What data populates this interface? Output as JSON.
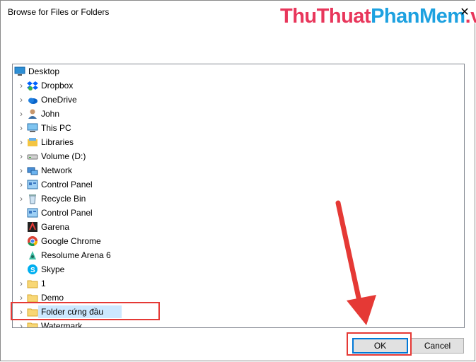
{
  "dialog": {
    "title": "Browse for Files or Folders",
    "watermark_part1": "ThuThuat",
    "watermark_part2": "PhanMem",
    "watermark_part3": ".vn",
    "close_symbol": "✕"
  },
  "tree": {
    "items": [
      {
        "label": "Desktop",
        "icon": "desktop-icon",
        "expander": false,
        "indent": 0
      },
      {
        "label": "Dropbox",
        "icon": "dropbox-icon",
        "expander": true,
        "indent": 1
      },
      {
        "label": "OneDrive",
        "icon": "onedrive-icon",
        "expander": true,
        "indent": 1
      },
      {
        "label": "John",
        "icon": "user-icon",
        "expander": true,
        "indent": 1
      },
      {
        "label": "This PC",
        "icon": "this-pc-icon",
        "expander": true,
        "indent": 1
      },
      {
        "label": "Libraries",
        "icon": "libraries-icon",
        "expander": true,
        "indent": 1
      },
      {
        "label": "Volume (D:)",
        "icon": "drive-icon",
        "expander": true,
        "indent": 1
      },
      {
        "label": "Network",
        "icon": "network-icon",
        "expander": true,
        "indent": 1
      },
      {
        "label": "Control Panel",
        "icon": "control-panel-icon",
        "expander": true,
        "indent": 1
      },
      {
        "label": "Recycle Bin",
        "icon": "recycle-bin-icon",
        "expander": true,
        "indent": 1
      },
      {
        "label": "Control Panel",
        "icon": "control-panel-icon",
        "expander": false,
        "indent": 1
      },
      {
        "label": "Garena",
        "icon": "garena-icon",
        "expander": false,
        "indent": 1
      },
      {
        "label": "Google Chrome",
        "icon": "chrome-icon",
        "expander": false,
        "indent": 1
      },
      {
        "label": "Resolume Arena 6",
        "icon": "resolume-icon",
        "expander": false,
        "indent": 1
      },
      {
        "label": "Skype",
        "icon": "skype-icon",
        "expander": false,
        "indent": 1
      },
      {
        "label": "1",
        "icon": "folder-icon",
        "expander": true,
        "indent": 1
      },
      {
        "label": "Demo",
        "icon": "folder-icon",
        "expander": true,
        "indent": 1
      },
      {
        "label": "Folder cứng đầu",
        "icon": "folder-icon",
        "expander": true,
        "indent": 1,
        "selected": true
      },
      {
        "label": "Watermark",
        "icon": "folder-icon",
        "expander": true,
        "indent": 1
      }
    ]
  },
  "buttons": {
    "ok_label": "OK",
    "cancel_label": "Cancel"
  },
  "scrollbar": {
    "up_symbol": "▲",
    "down_symbol": "▼"
  },
  "colors": {
    "selection": "#cce8ff",
    "annotation_red": "#e53935",
    "ok_border": "#0078d7"
  }
}
